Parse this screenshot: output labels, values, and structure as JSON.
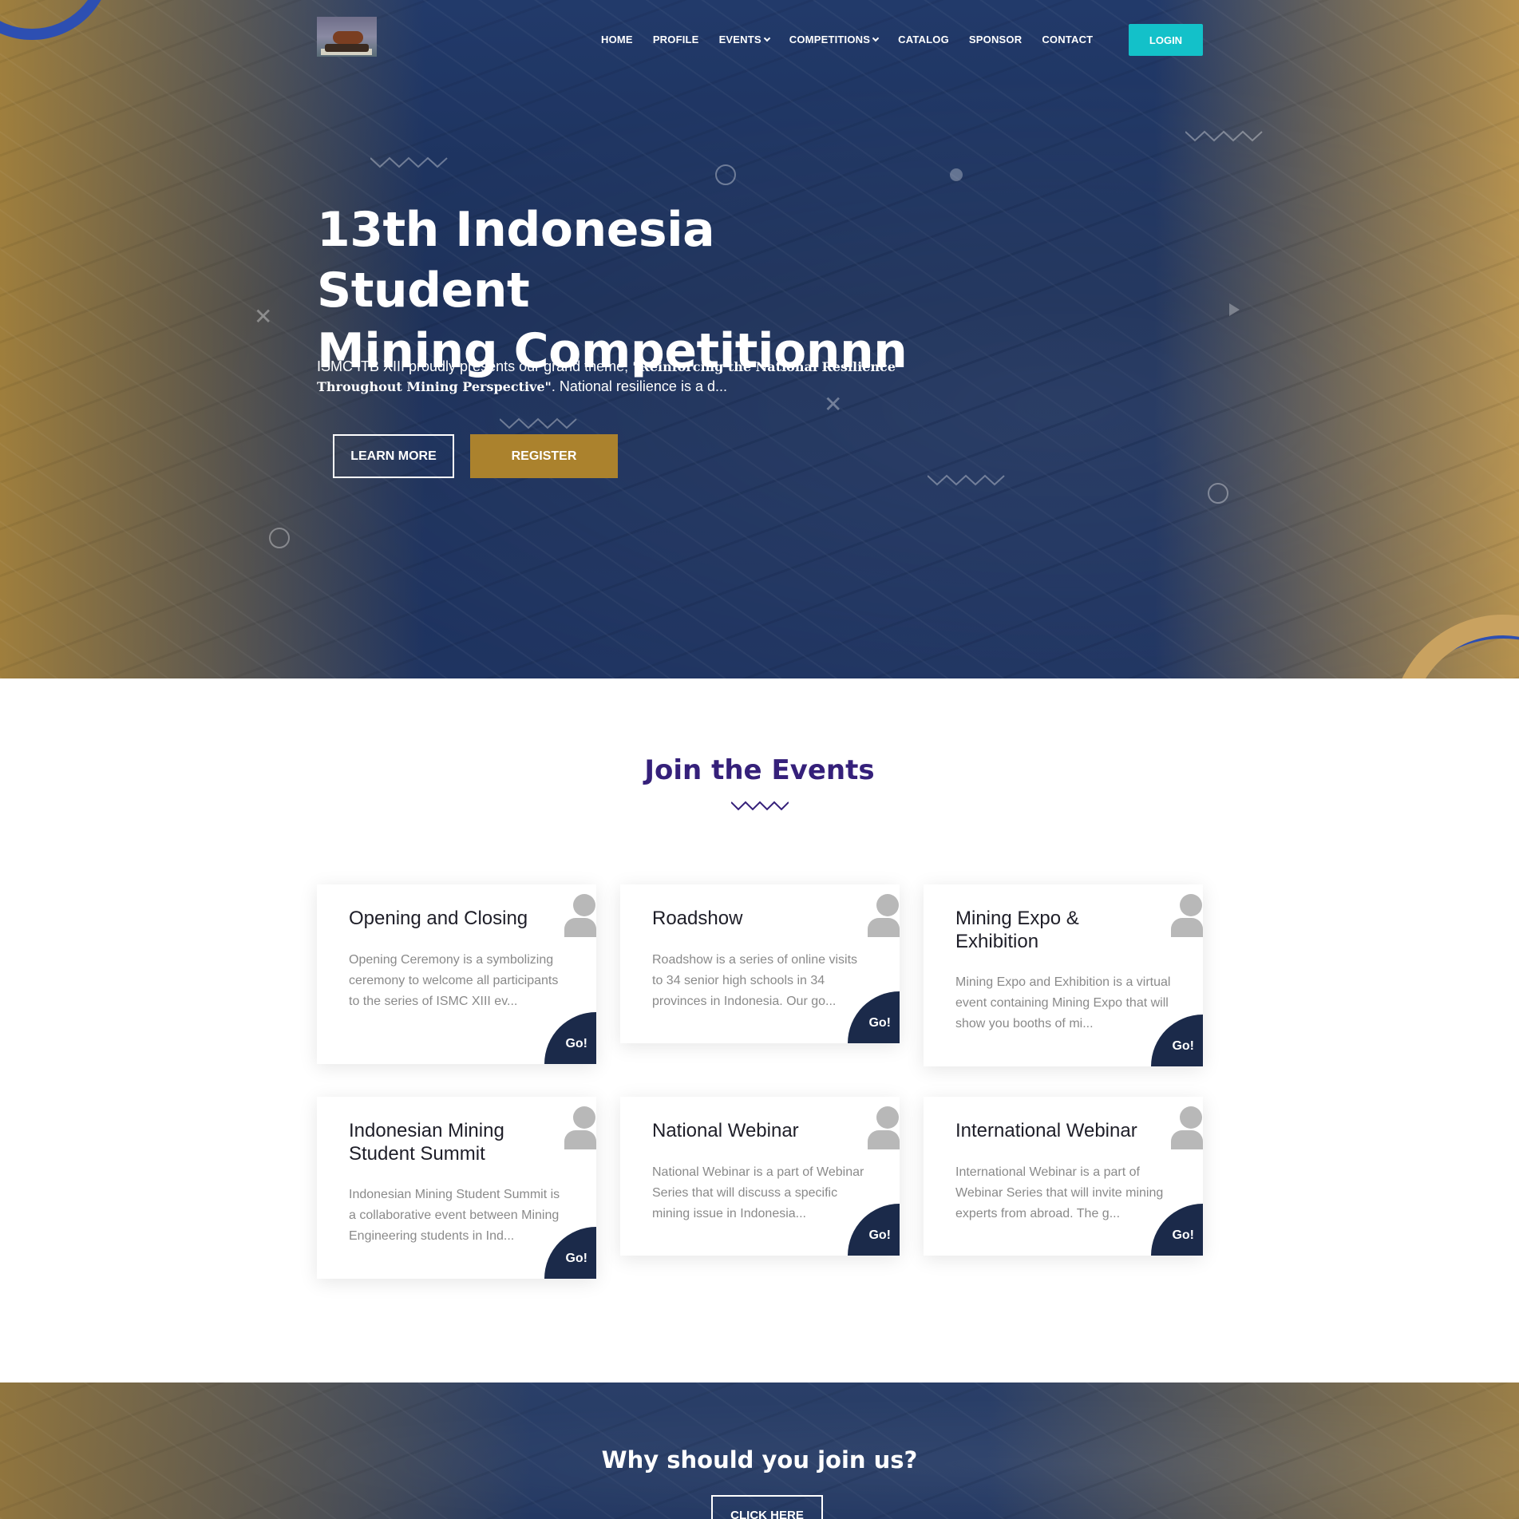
{
  "nav": {
    "items": [
      {
        "label": "HOME",
        "dropdown": false
      },
      {
        "label": "PROFILE",
        "dropdown": false
      },
      {
        "label": "EVENTS",
        "dropdown": true
      },
      {
        "label": "COMPETITIONS",
        "dropdown": true
      },
      {
        "label": "CATALOG",
        "dropdown": false
      },
      {
        "label": "SPONSOR",
        "dropdown": false
      },
      {
        "label": "CONTACT",
        "dropdown": false
      }
    ],
    "login_label": "LOGIN"
  },
  "hero": {
    "title_line1": "13th Indonesia Student",
    "title_line2": "Mining Competitionnn",
    "desc_prefix": "ISMC ITB XIII proudly presents our grand theme, ",
    "desc_theme": "\"Reinforcing the National Resilience Throughout Mining Perspective\"",
    "desc_suffix": ". National resilience is a d...",
    "learn_more_label": "LEARN MORE",
    "register_label": "REGISTER"
  },
  "events": {
    "title": "Join the Events",
    "go_label": "Go!",
    "cards": [
      {
        "title": "Opening and Closing",
        "desc": "Opening Ceremony is a symbolizing ceremony to welcome all participants to the series of ISMC XIII ev..."
      },
      {
        "title": "Roadshow",
        "desc": "Roadshow is a series of online visits to 34 senior high schools in 34 provinces in Indonesia. Our go..."
      },
      {
        "title": "Mining Expo & Exhibition",
        "desc": "Mining Expo and Exhibition is a virtual event containing Mining Expo that will show you booths of mi..."
      },
      {
        "title": "Indonesian Mining Student Summit",
        "desc": "Indonesian Mining Student Summit is a collaborative event between Mining Engineering students in Ind..."
      },
      {
        "title": "National Webinar",
        "desc": "National Webinar is a part of Webinar Series that will discuss a specific mining issue in Indonesia..."
      },
      {
        "title": "International Webinar",
        "desc": "International Webinar is a part of Webinar Series that will invite mining experts from abroad. The g..."
      }
    ]
  },
  "band": {
    "title": "Why should you join us?",
    "button_label": "CLICK HERE"
  },
  "colors": {
    "navy": "#1b2a4a",
    "accent_teal": "#13c1c9",
    "accent_gold": "#ab822d",
    "heading_purple": "#35207a"
  }
}
